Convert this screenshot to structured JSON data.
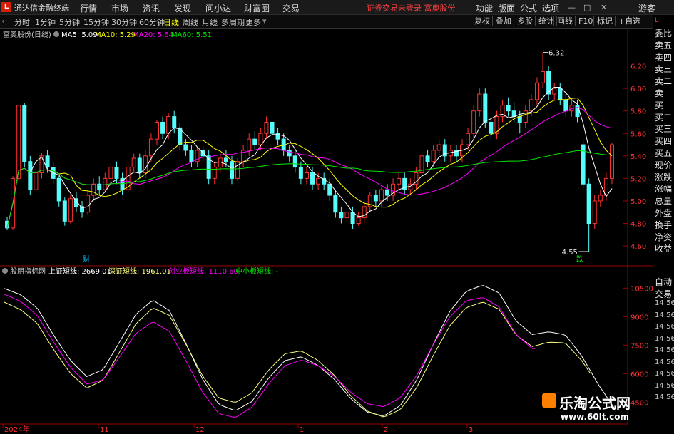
{
  "app": {
    "logo": "L",
    "name": "通达信金融终端"
  },
  "menu": [
    "行情",
    "市场",
    "资讯",
    "发现",
    "问小达",
    "财富圈",
    "交易"
  ],
  "notice": "证券交易未登录  富奥股份",
  "rmenu": [
    "功能",
    "版面",
    "公式",
    "选项"
  ],
  "guest": "游客",
  "period_tabs": [
    "分时",
    "1分钟",
    "5分钟",
    "15分钟",
    "30分钟",
    "60分钟",
    "日线",
    "周线",
    "月线",
    "多周期",
    "更多"
  ],
  "active_period": "日线",
  "toolbar_right": [
    "复权",
    "叠加",
    "多股",
    "统计",
    "画线",
    "F10",
    "标记",
    "+自选"
  ],
  "main_header": {
    "title": "富奥股份(日线)",
    "ma5": "MA5: 5.09",
    "ma10": "MA10: 5.29",
    "ma20": "MA20: 5.64",
    "ma60": "MA60: 5.51"
  },
  "sub_header": {
    "title": "股朋指标网",
    "sh": "上证短线: 2669.01",
    "sz": "深证短线: 1961.01",
    "cyb": "创业板短线: 1110.60",
    "zxb": "中小板短线: -"
  },
  "price_labels": [
    "6.20",
    "6.00",
    "5.80",
    "5.60",
    "5.40",
    "5.20",
    "5.00",
    "4.80",
    "4.60"
  ],
  "sub_labels": [
    "10500",
    "9000",
    "7500",
    "6000",
    "4500"
  ],
  "high_mark": "6.32",
  "low_mark": "4.55",
  "event_cai": "财",
  "event_die": "跌",
  "time_labels": [
    "2024年",
    "11",
    "12",
    "1",
    "2",
    "3"
  ],
  "right_panel": [
    "委比",
    "卖五",
    "卖四",
    "卖三",
    "卖二",
    "卖一",
    "买一",
    "买二",
    "买三",
    "买四",
    "买五",
    "现价",
    "涨跌",
    "涨幅",
    "总量",
    "外盘",
    "换手",
    "净资",
    "收益"
  ],
  "right_panel_bottom": [
    "自动",
    "交易",
    "14:56",
    "14:56",
    "14:56",
    "14:56",
    "14:56",
    "14:56",
    "14:56",
    "14:56",
    "14:56"
  ],
  "watermark": {
    "title": "乐淘公式网",
    "url": "www.60lt.com"
  },
  "colors": {
    "up": "#ff3232",
    "down": "#54fcfc",
    "ma5": "#ffffff",
    "ma10": "#ffff00",
    "ma20": "#ff00ff",
    "ma60": "#00e600",
    "sh": "#ffffff",
    "sz": "#ffff80",
    "cyb": "#ff00ff",
    "zxb": "#00e600"
  },
  "chart_data": {
    "type": "candlestick",
    "y_range": [
      4.48,
      6.4
    ],
    "candles": [
      [
        4.82,
        4.76,
        4.86,
        4.74
      ],
      [
        4.76,
        5.2,
        5.22,
        4.74
      ],
      [
        5.2,
        5.85,
        5.85,
        5.18
      ],
      [
        5.85,
        5.35,
        5.87,
        5.3
      ],
      [
        5.35,
        5.1,
        5.4,
        5.05
      ],
      [
        5.1,
        5.25,
        5.3,
        5.08
      ],
      [
        5.25,
        5.4,
        5.43,
        5.2
      ],
      [
        5.4,
        5.3,
        5.45,
        5.25
      ],
      [
        5.3,
        5.2,
        5.35,
        5.15
      ],
      [
        5.2,
        5.0,
        5.22,
        4.95
      ],
      [
        5.0,
        4.82,
        5.03,
        4.78
      ],
      [
        4.82,
        5.02,
        5.05,
        4.8
      ],
      [
        5.02,
        4.95,
        5.08,
        4.9
      ],
      [
        4.95,
        4.9,
        5.0,
        4.85
      ],
      [
        4.9,
        5.05,
        5.1,
        4.88
      ],
      [
        5.05,
        5.15,
        5.2,
        5.0
      ],
      [
        5.15,
        5.1,
        5.22,
        5.05
      ],
      [
        5.1,
        5.2,
        5.25,
        5.08
      ],
      [
        5.2,
        5.3,
        5.35,
        5.15
      ],
      [
        5.3,
        5.2,
        5.35,
        5.15
      ],
      [
        5.2,
        5.1,
        5.25,
        5.05
      ],
      [
        5.1,
        5.3,
        5.35,
        5.08
      ],
      [
        5.3,
        5.38,
        5.42,
        5.25
      ],
      [
        5.38,
        5.25,
        5.42,
        5.2
      ],
      [
        5.25,
        5.4,
        5.45,
        5.2
      ],
      [
        5.4,
        5.55,
        5.6,
        5.35
      ],
      [
        5.55,
        5.7,
        5.72,
        5.5
      ],
      [
        5.7,
        5.6,
        5.75,
        5.55
      ],
      [
        5.6,
        5.75,
        5.78,
        5.55
      ],
      [
        5.75,
        5.65,
        5.8,
        5.6
      ],
      [
        5.65,
        5.5,
        5.7,
        5.45
      ],
      [
        5.5,
        5.45,
        5.55,
        5.4
      ],
      [
        5.45,
        5.35,
        5.5,
        5.3
      ],
      [
        5.35,
        5.45,
        5.48,
        5.3
      ],
      [
        5.45,
        5.4,
        5.5,
        5.35
      ],
      [
        5.4,
        5.2,
        5.45,
        5.15
      ],
      [
        5.2,
        5.3,
        5.35,
        5.15
      ],
      [
        5.3,
        5.38,
        5.42,
        5.25
      ],
      [
        5.38,
        5.35,
        5.45,
        5.3
      ],
      [
        5.35,
        5.2,
        5.4,
        5.15
      ],
      [
        5.2,
        5.35,
        5.38,
        5.18
      ],
      [
        5.35,
        5.45,
        5.5,
        5.3
      ],
      [
        5.45,
        5.55,
        5.6,
        5.4
      ],
      [
        5.55,
        5.5,
        5.62,
        5.45
      ],
      [
        5.5,
        5.6,
        5.65,
        5.45
      ],
      [
        5.6,
        5.7,
        5.75,
        5.55
      ],
      [
        5.7,
        5.6,
        5.75,
        5.55
      ],
      [
        5.6,
        5.55,
        5.65,
        5.5
      ],
      [
        5.55,
        5.45,
        5.6,
        5.4
      ],
      [
        5.45,
        5.4,
        5.5,
        5.35
      ],
      [
        5.4,
        5.3,
        5.45,
        5.25
      ],
      [
        5.3,
        5.2,
        5.35,
        5.15
      ],
      [
        5.2,
        5.25,
        5.3,
        5.15
      ],
      [
        5.25,
        5.15,
        5.3,
        5.1
      ],
      [
        5.15,
        5.2,
        5.25,
        5.1
      ],
      [
        5.2,
        5.15,
        5.25,
        5.1
      ],
      [
        5.15,
        5.05,
        5.2,
        5.0
      ],
      [
        5.05,
        4.9,
        5.1,
        4.85
      ],
      [
        4.9,
        4.85,
        4.95,
        4.8
      ],
      [
        4.85,
        4.9,
        4.95,
        4.8
      ],
      [
        4.9,
        4.8,
        4.95,
        4.75
      ],
      [
        4.8,
        4.85,
        4.9,
        4.78
      ],
      [
        4.85,
        4.95,
        5.0,
        4.8
      ],
      [
        4.95,
        5.05,
        5.08,
        4.9
      ],
      [
        5.05,
        5.0,
        5.1,
        4.95
      ],
      [
        5.0,
        5.1,
        5.12,
        4.95
      ],
      [
        5.1,
        5.05,
        5.15,
        5.0
      ],
      [
        5.05,
        5.15,
        5.2,
        5.0
      ],
      [
        5.15,
        5.2,
        5.25,
        5.1
      ],
      [
        5.2,
        5.1,
        5.25,
        5.05
      ],
      [
        5.1,
        5.15,
        5.2,
        5.05
      ],
      [
        5.15,
        5.25,
        5.3,
        5.1
      ],
      [
        5.25,
        5.4,
        5.45,
        5.2
      ],
      [
        5.4,
        5.35,
        5.45,
        5.3
      ],
      [
        5.35,
        5.45,
        5.5,
        5.3
      ],
      [
        5.45,
        5.5,
        5.55,
        5.4
      ],
      [
        5.5,
        5.4,
        5.55,
        5.35
      ],
      [
        5.4,
        5.45,
        5.5,
        5.35
      ],
      [
        5.45,
        5.4,
        5.5,
        5.35
      ],
      [
        5.4,
        5.5,
        5.55,
        5.35
      ],
      [
        5.5,
        5.6,
        5.65,
        5.45
      ],
      [
        5.6,
        5.8,
        5.85,
        5.55
      ],
      [
        5.8,
        5.95,
        6.0,
        5.75
      ],
      [
        5.95,
        5.7,
        6.0,
        5.65
      ],
      [
        5.7,
        5.6,
        5.75,
        5.55
      ],
      [
        5.6,
        5.75,
        5.8,
        5.55
      ],
      [
        5.75,
        5.85,
        5.9,
        5.7
      ],
      [
        5.85,
        5.8,
        5.92,
        5.75
      ],
      [
        5.8,
        5.75,
        5.88,
        5.7
      ],
      [
        5.75,
        5.7,
        5.8,
        5.6
      ],
      [
        5.7,
        5.8,
        5.85,
        5.65
      ],
      [
        5.8,
        5.9,
        5.95,
        5.75
      ],
      [
        5.9,
        6.05,
        6.1,
        5.85
      ],
      [
        6.05,
        6.15,
        6.32,
        6.0
      ],
      [
        6.15,
        5.95,
        6.2,
        5.9
      ],
      [
        5.95,
        6.0,
        6.05,
        5.9
      ],
      [
        6.0,
        5.9,
        6.05,
        5.85
      ],
      [
        5.9,
        5.8,
        5.95,
        5.75
      ],
      [
        5.8,
        5.85,
        5.9,
        5.75
      ],
      [
        5.85,
        5.75,
        5.9,
        5.7
      ],
      [
        5.5,
        5.15,
        5.55,
        5.1
      ],
      [
        5.15,
        4.8,
        5.2,
        4.55
      ],
      [
        4.8,
        5.0,
        5.05,
        4.75
      ],
      [
        5.0,
        5.05,
        5.1,
        4.95
      ],
      [
        5.05,
        5.2,
        5.25,
        5.0
      ],
      [
        5.2,
        5.5,
        5.52,
        5.15
      ]
    ],
    "sub_series": [
      {
        "name": "上证短线",
        "color": "#ffffff"
      },
      {
        "name": "深证短线",
        "color": "#ffff80"
      },
      {
        "name": "创业板短线",
        "color": "#ff00ff"
      }
    ]
  }
}
